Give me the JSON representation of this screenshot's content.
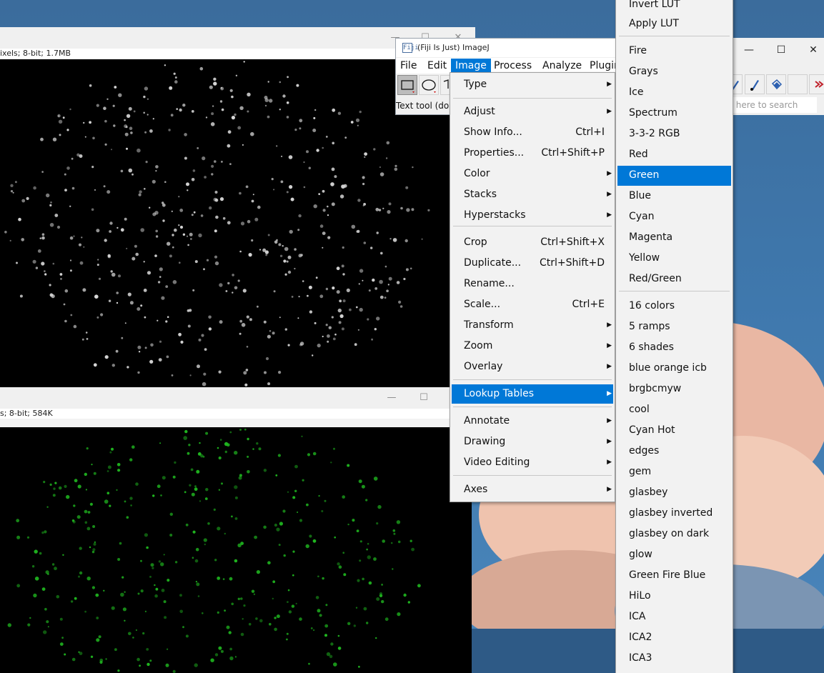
{
  "colors": {
    "accent": "#0078d7",
    "menu_bg": "#f2f2f2",
    "image_bg": "#000000",
    "green_channel": "#1fb51f"
  },
  "image_windows": [
    {
      "info": "ixels; 8-bit; 1.7MB"
    },
    {
      "info": "s; 8-bit; 584K"
    }
  ],
  "imagej": {
    "title": "(Fiji Is Just) ImageJ",
    "logo": "Fiji",
    "menus": [
      "File",
      "Edit",
      "Image",
      "Process",
      "Analyze",
      "Plugir"
    ],
    "active_menu": "Image",
    "status": "Text tool (dou",
    "search_placeholder": "k here to search",
    "toolbar_icons": [
      "rectangle-tool-icon",
      "oval-tool-icon",
      "polygon-tool-icon",
      "pencil-icon",
      "brush-icon",
      "flood-fill-icon",
      "more-tools-icon"
    ]
  },
  "image_menu": {
    "items": [
      {
        "label": "Type",
        "submenu": true
      },
      {
        "label": "Adjust",
        "submenu": true
      },
      {
        "label": "Show Info...",
        "shortcut": "Ctrl+I"
      },
      {
        "label": "Properties...",
        "shortcut": "Ctrl+Shift+P"
      },
      {
        "label": "Color",
        "submenu": true
      },
      {
        "label": "Stacks",
        "submenu": true
      },
      {
        "label": "Hyperstacks",
        "submenu": true
      },
      {
        "label": "Crop",
        "shortcut": "Ctrl+Shift+X"
      },
      {
        "label": "Duplicate...",
        "shortcut": "Ctrl+Shift+D"
      },
      {
        "label": "Rename..."
      },
      {
        "label": "Scale...",
        "shortcut": "Ctrl+E"
      },
      {
        "label": "Transform",
        "submenu": true
      },
      {
        "label": "Zoom",
        "submenu": true
      },
      {
        "label": "Overlay",
        "submenu": true
      },
      {
        "label": "Lookup Tables",
        "submenu": true,
        "highlighted": true
      },
      {
        "label": "Annotate",
        "submenu": true
      },
      {
        "label": "Drawing",
        "submenu": true
      },
      {
        "label": "Video Editing",
        "submenu": true
      },
      {
        "label": "Axes",
        "submenu": true
      }
    ]
  },
  "lut_menu": {
    "items": [
      {
        "label": "Invert LUT"
      },
      {
        "label": "Apply LUT"
      },
      {
        "label": "Fire"
      },
      {
        "label": "Grays"
      },
      {
        "label": "Ice"
      },
      {
        "label": "Spectrum"
      },
      {
        "label": "3-3-2 RGB"
      },
      {
        "label": "Red"
      },
      {
        "label": "Green",
        "highlighted": true
      },
      {
        "label": "Blue"
      },
      {
        "label": "Cyan"
      },
      {
        "label": "Magenta"
      },
      {
        "label": "Yellow"
      },
      {
        "label": "Red/Green"
      },
      {
        "label": "16 colors"
      },
      {
        "label": "5 ramps"
      },
      {
        "label": "6 shades"
      },
      {
        "label": "blue orange icb"
      },
      {
        "label": "brgbcmyw"
      },
      {
        "label": "cool"
      },
      {
        "label": "Cyan Hot"
      },
      {
        "label": "edges"
      },
      {
        "label": "gem"
      },
      {
        "label": "glasbey"
      },
      {
        "label": "glasbey inverted"
      },
      {
        "label": "glasbey on dark"
      },
      {
        "label": "glow"
      },
      {
        "label": "Green Fire Blue"
      },
      {
        "label": "HiLo"
      },
      {
        "label": "ICA"
      },
      {
        "label": "ICA2"
      },
      {
        "label": "ICA3"
      }
    ]
  }
}
